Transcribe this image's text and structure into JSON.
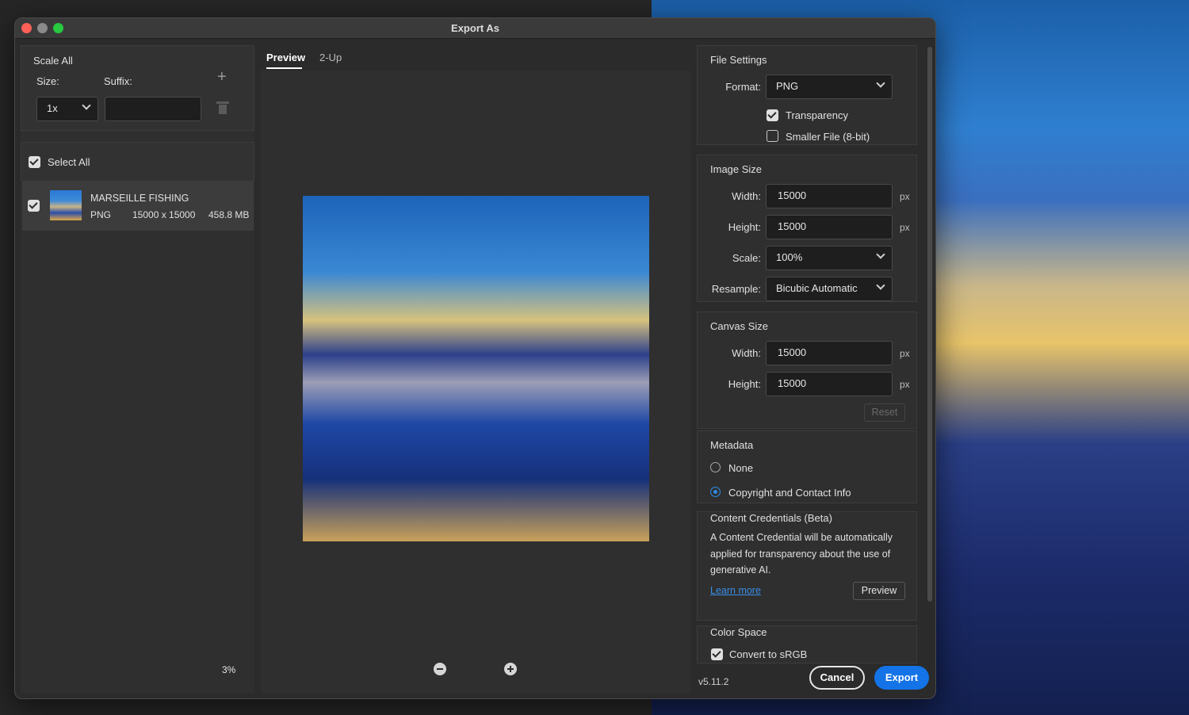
{
  "window": {
    "title": "Export As"
  },
  "scale_all": {
    "heading": "Scale All",
    "size_label": "Size:",
    "suffix_label": "Suffix:",
    "size_value": "1x",
    "suffix_value": ""
  },
  "assets": {
    "select_all_label": "Select All",
    "items": [
      {
        "name": "MARSEILLE FISHING",
        "format": "PNG",
        "dimensions": "15000 x 15000",
        "file_size": "458.8 MB"
      }
    ]
  },
  "preview": {
    "tabs": [
      "Preview",
      "2-Up"
    ],
    "zoom": "3%"
  },
  "file_settings": {
    "heading": "File Settings",
    "format_label": "Format:",
    "format_value": "PNG",
    "transparency_label": "Transparency",
    "smaller_file_label": "Smaller File (8-bit)"
  },
  "image_size": {
    "heading": "Image Size",
    "width_label": "Width:",
    "width_value": "15000",
    "height_label": "Height:",
    "height_value": "15000",
    "unit": "px",
    "scale_label": "Scale:",
    "scale_value": "100%",
    "resample_label": "Resample:",
    "resample_value": "Bicubic Automatic"
  },
  "canvas_size": {
    "heading": "Canvas Size",
    "width_label": "Width:",
    "width_value": "15000",
    "height_label": "Height:",
    "height_value": "15000",
    "unit": "px",
    "reset_label": "Reset"
  },
  "metadata": {
    "heading": "Metadata",
    "option_none": "None",
    "option_copyright": "Copyright and Contact Info"
  },
  "content_credentials": {
    "heading": "Content Credentials (Beta)",
    "description": "A Content Credential will be automatically applied for transparency about the use of generative AI.",
    "learn_more": "Learn more",
    "preview_label": "Preview"
  },
  "color_space": {
    "heading": "Color Space",
    "convert_label": "Convert to sRGB"
  },
  "footer": {
    "version": "v5.11.2",
    "cancel_label": "Cancel",
    "export_label": "Export"
  },
  "colors": {
    "accent": "#1473e6",
    "link": "#3b8fe8"
  }
}
